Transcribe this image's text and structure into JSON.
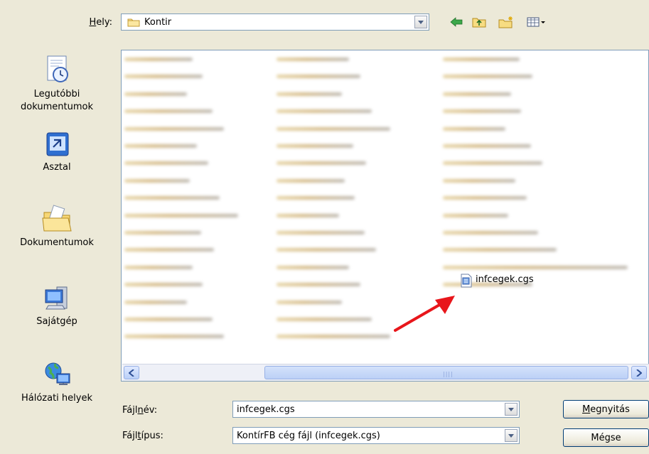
{
  "lookin": {
    "label_key": "H",
    "label_rest": "ely:",
    "value": "Kontir"
  },
  "places": [
    {
      "line1": "Legutóbbi",
      "line2": "dokumentumok",
      "icon": "recent-documents-icon"
    },
    {
      "line1": "Asztal",
      "line2": "",
      "icon": "desktop-icon"
    },
    {
      "line1": "Dokumentumok",
      "line2": "",
      "icon": "my-documents-icon"
    },
    {
      "line1": "Sajátgép",
      "line2": "",
      "icon": "my-computer-icon"
    },
    {
      "line1": "Hálózati helyek",
      "line2": "",
      "icon": "network-places-icon"
    }
  ],
  "file": {
    "name": "infcegek.cgs",
    "icon": "cgs-file-icon"
  },
  "filename": {
    "label_pre": "Fájl",
    "label_key": "n",
    "label_post": "év:",
    "value": "infcegek.cgs"
  },
  "filetype": {
    "label_pre": "Fájl",
    "label_key": "t",
    "label_post": "ípus:",
    "value": "KontírFB cég fájl (infcegek.cgs)"
  },
  "buttons": {
    "open_key": "M",
    "open_rest": "egnyitás",
    "cancel": "Mégse"
  },
  "colors": {
    "arrow": "#e8161b",
    "window_bg": "#ece9d8",
    "border": "#7f9db9"
  }
}
